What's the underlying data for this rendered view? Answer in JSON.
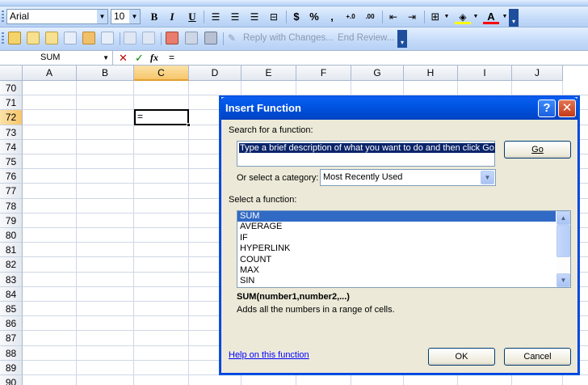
{
  "toolbar_format": {
    "font_name": "Arial",
    "font_size": "10",
    "bold": "B",
    "italic": "I",
    "underline": "U",
    "currency": "$",
    "percent": "%",
    "comma": ",",
    "increase_decimal": "+.0",
    "decrease_decimal": ".00",
    "font_color_letter": "A"
  },
  "toolbar_review": {
    "reply_with_changes": "Reply with Changes...",
    "end_review": "End Review..."
  },
  "formula_bar": {
    "name_box": "SUM",
    "cancel": "✕",
    "enter": "✓",
    "fx": "fx",
    "content": "="
  },
  "sheet": {
    "columns": [
      "A",
      "B",
      "C",
      "D",
      "E",
      "F",
      "G",
      "H",
      "I",
      "J"
    ],
    "selected_column": "C",
    "rows": [
      "70",
      "71",
      "72",
      "73",
      "74",
      "75",
      "76",
      "77",
      "78",
      "79",
      "80",
      "81",
      "82",
      "83",
      "84",
      "85",
      "86",
      "87",
      "88",
      "89",
      "90"
    ],
    "selected_row": "72",
    "active_cell_value": "="
  },
  "dialog": {
    "title": "Insert Function",
    "help_glyph": "?",
    "close_glyph": "✕",
    "search_label": "Search for a function:",
    "search_text": "Type a brief description of what you want to do and then click Go",
    "go_button": "Go",
    "category_label": "Or select a category:",
    "category_value": "Most Recently Used",
    "select_label": "Select a function:",
    "functions": [
      "SUM",
      "AVERAGE",
      "IF",
      "HYPERLINK",
      "COUNT",
      "MAX",
      "SIN"
    ],
    "selected_function": "SUM",
    "signature": "SUM(number1,number2,...)",
    "description": "Adds all the numbers in a range of cells.",
    "help_link": "Help on this function",
    "ok_button": "OK",
    "cancel_button": "Cancel"
  },
  "colors": {
    "title_bar": "#0054e3",
    "selection": "#316ac5",
    "header_highlight": "#f7c66b",
    "toolbar": "#c4dbf9"
  }
}
